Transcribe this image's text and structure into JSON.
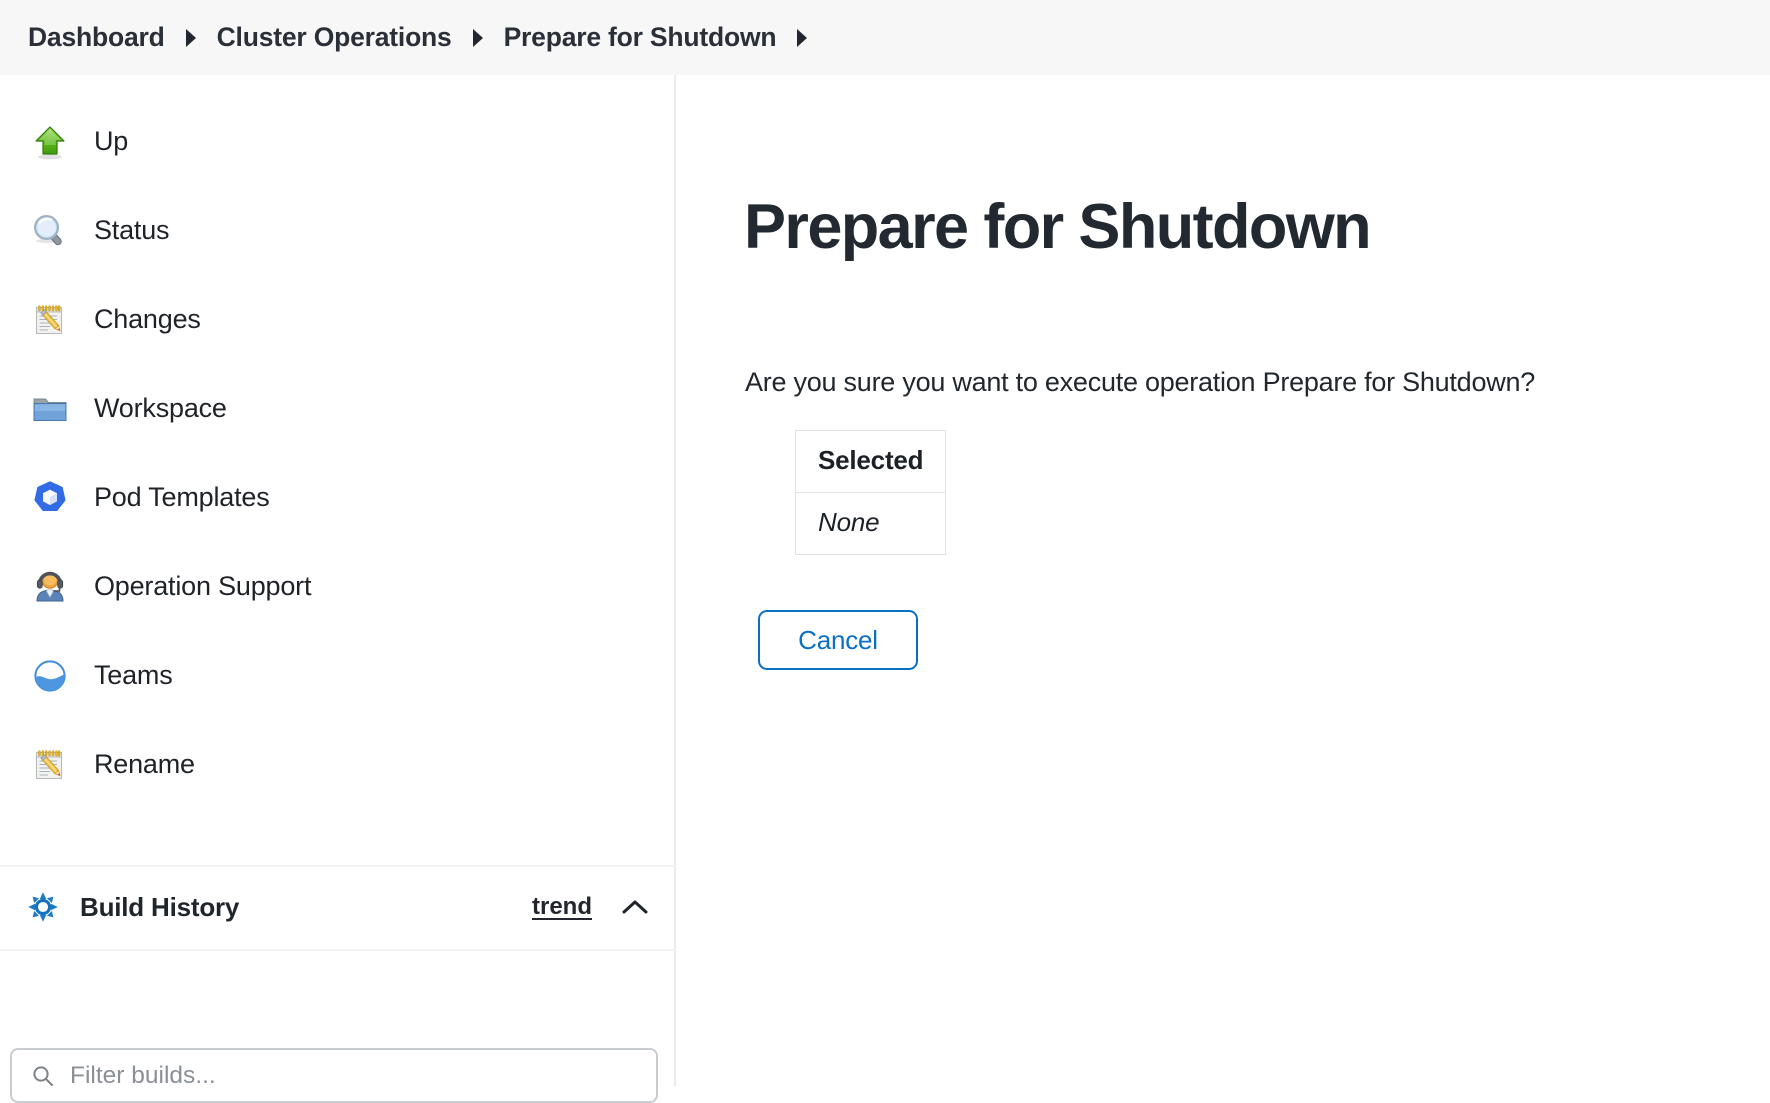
{
  "breadcrumb": {
    "items": [
      {
        "label": "Dashboard"
      },
      {
        "label": "Cluster Operations"
      },
      {
        "label": "Prepare for Shutdown"
      }
    ],
    "separator_icon": "triangle-right-icon",
    "trailing_separator_icon": "triangle-right-icon"
  },
  "sidebar": {
    "tasks": [
      {
        "label": "Up",
        "icon": "green-up-arrow-icon"
      },
      {
        "label": "Status",
        "icon": "magnifier-icon"
      },
      {
        "label": "Changes",
        "icon": "notepad-pencil-icon"
      },
      {
        "label": "Workspace",
        "icon": "blue-folder-icon"
      },
      {
        "label": "Pod Templates",
        "icon": "kubernetes-cube-icon"
      },
      {
        "label": "Operation Support",
        "icon": "support-agent-icon"
      },
      {
        "label": "Teams",
        "icon": "teams-wave-circle-icon"
      },
      {
        "label": "Rename",
        "icon": "notepad-pencil-icon"
      }
    ],
    "build_history": {
      "title": "Build History",
      "icon": "build-history-star-icon",
      "trend_label": "trend",
      "collapse_icon": "chevron-up-icon"
    },
    "filter": {
      "placeholder": "Filter builds...",
      "value": "",
      "icon": "search-icon"
    }
  },
  "main": {
    "title": "Prepare for Shutdown",
    "question": "Are you sure you want to execute operation Prepare for Shutdown?",
    "selected_table": {
      "headers": [
        "Selected"
      ],
      "rows": [
        [
          "None"
        ]
      ]
    },
    "cancel_label": "Cancel"
  },
  "colors": {
    "accent_blue": "#0b6fc6",
    "header_bg": "#f7f7f8",
    "text": "#22272e",
    "divider": "#e7ecf0",
    "muted": "#8b9096"
  }
}
